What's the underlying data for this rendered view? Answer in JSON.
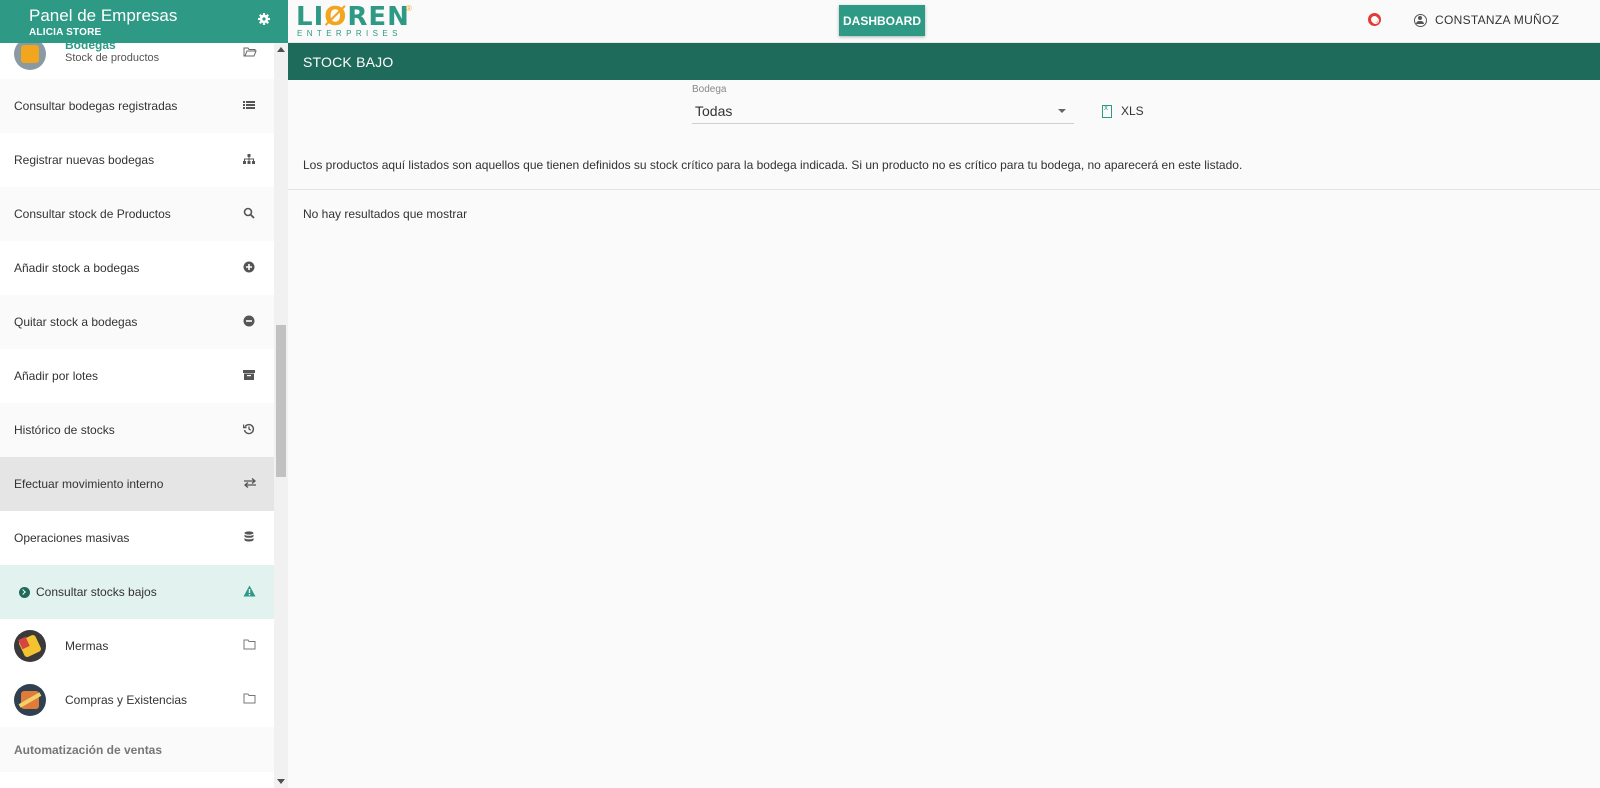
{
  "sidebar": {
    "title": "Panel de Empresas",
    "subtitle": "ALICIA STORE",
    "first": {
      "label": "Bodegas",
      "sublabel": "Stock de productos"
    },
    "items": [
      {
        "label": "Consultar bodegas registradas",
        "icon": "list-icon"
      },
      {
        "label": "Registrar nuevas bodegas",
        "icon": "sitemap-icon"
      },
      {
        "label": "Consultar stock de Productos",
        "icon": "search-icon"
      },
      {
        "label": "Añadir stock a bodegas",
        "icon": "plus-circle-icon"
      },
      {
        "label": "Quitar stock a bodegas",
        "icon": "minus-circle-icon"
      },
      {
        "label": "Añadir por lotes",
        "icon": "archive-icon"
      },
      {
        "label": "Histórico de stocks",
        "icon": "history-icon"
      },
      {
        "label": "Efectuar movimiento interno",
        "icon": "exchange-icon"
      },
      {
        "label": "Operaciones masivas",
        "icon": "database-icon"
      },
      {
        "label": "Consultar stocks bajos",
        "icon": "warning-icon"
      }
    ],
    "modules": [
      {
        "label": "Mermas",
        "icon": "folder-icon"
      },
      {
        "label": "Compras y Existencias",
        "icon": "folder-icon"
      }
    ],
    "section": "Automatización de ventas"
  },
  "topbar": {
    "logo_main": "LIOREN",
    "logo_sub": "ENTERPRISES",
    "dashboard_label": "DASHBOARD",
    "user_name": "CONSTANZA MUÑOZ"
  },
  "main": {
    "title": "STOCK BAJO",
    "filter_label": "Bodega",
    "filter_value": "Todas",
    "export_label": "XLS",
    "info": "Los productos aquí listados son aquellos que tienen definidos su stock crítico para la bodega indicada. Si un producto no es crítico para tu bodega, no aparecerá en este listado.",
    "empty": "No hay resultados que mostrar"
  },
  "colors": {
    "brand": "#2e9a86",
    "brand_dark": "#1f6b5b",
    "accent": "#f2a51f",
    "active_bg": "#e1f2ef"
  }
}
